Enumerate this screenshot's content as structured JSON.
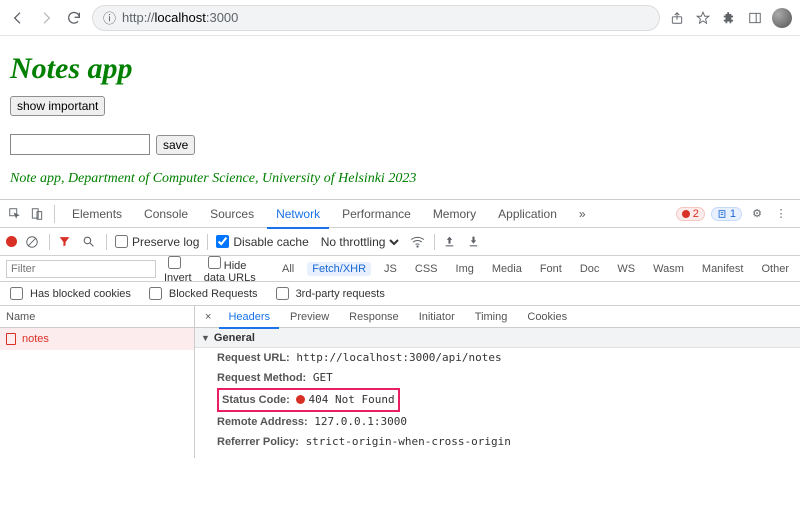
{
  "browser": {
    "url_scheme_host": "http://",
    "url_dark": "localhost",
    "url_rest": ":3000"
  },
  "page": {
    "title": "Notes app",
    "show_important_btn": "show important",
    "save_btn": "save",
    "footer": "Note app, Department of Computer Science, University of Helsinki 2023"
  },
  "devtools": {
    "tabs": [
      "Elements",
      "Console",
      "Sources",
      "Network",
      "Performance",
      "Memory",
      "Application"
    ],
    "selected_tab": "Network",
    "errors": "2",
    "infos": "1",
    "row2": {
      "preserve_log": "Preserve log",
      "disable_cache": "Disable cache",
      "throttle": "No throttling"
    },
    "row3": {
      "filter_placeholder": "Filter",
      "invert": "Invert",
      "hide_data_urls": "Hide data URLs",
      "types": [
        "All",
        "Fetch/XHR",
        "JS",
        "CSS",
        "Img",
        "Media",
        "Font",
        "Doc",
        "WS",
        "Wasm",
        "Manifest",
        "Other"
      ],
      "selected_type": "Fetch/XHR"
    },
    "row4": {
      "blocked_cookies": "Has blocked cookies",
      "blocked_requests": "Blocked Requests",
      "third_party": "3rd-party requests"
    },
    "left": {
      "name_col": "Name",
      "request_name": "notes"
    },
    "detail_tabs": [
      "Headers",
      "Preview",
      "Response",
      "Initiator",
      "Timing",
      "Cookies"
    ],
    "selected_detail_tab": "Headers",
    "general_label": "General",
    "headers": {
      "request_url_k": "Request URL:",
      "request_url_v": "http://localhost:3000/api/notes",
      "request_method_k": "Request Method:",
      "request_method_v": "GET",
      "status_code_k": "Status Code:",
      "status_code_v": "404 Not Found",
      "remote_addr_k": "Remote Address:",
      "remote_addr_v": "127.0.0.1:3000",
      "referrer_policy_k": "Referrer Policy:",
      "referrer_policy_v": "strict-origin-when-cross-origin"
    }
  }
}
